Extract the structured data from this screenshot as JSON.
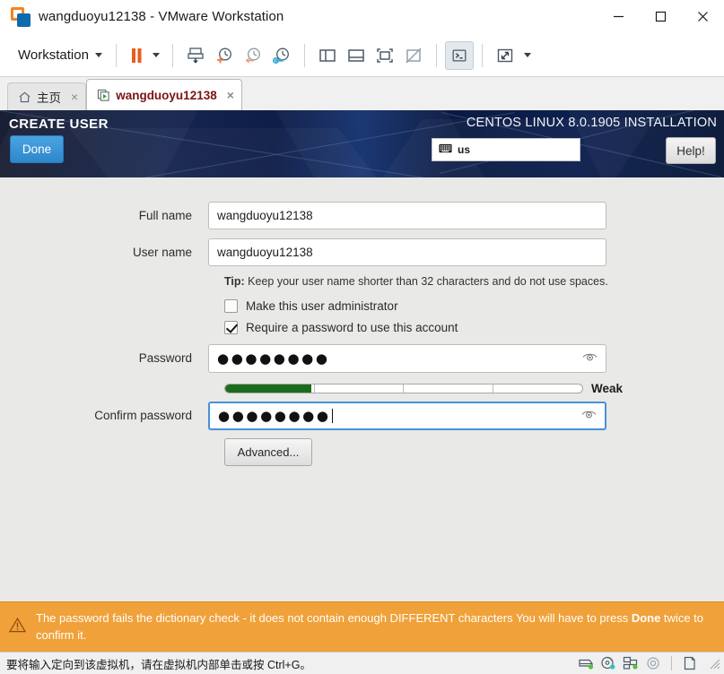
{
  "window": {
    "title": "wangduoyu12138 - VMware Workstation",
    "logo_icon": "vmware-logo-icon",
    "minimize_label": "minimize-icon",
    "maximize_label": "maximize-icon",
    "close_label": "close-icon"
  },
  "toolbar": {
    "menu_label": "Workstation",
    "buttons": [
      {
        "name": "pause-button",
        "icon": "pause-icon"
      },
      {
        "name": "pause-dropdown",
        "icon": "chevron-down-icon"
      },
      {
        "name": "manage-snapshot-button",
        "icon": "snapshot-manage-icon"
      },
      {
        "name": "take-snapshot-button",
        "icon": "snapshot-take-icon"
      },
      {
        "name": "revert-snapshot-button",
        "icon": "snapshot-revert-icon"
      },
      {
        "name": "snapshot-manager-button",
        "icon": "snapshot-manager-icon"
      },
      {
        "name": "show-library-button",
        "icon": "panel-left-icon"
      },
      {
        "name": "show-thumbnail-bar-button",
        "icon": "panel-bottom-icon"
      },
      {
        "name": "full-screen-button",
        "icon": "fullscreen-icon"
      },
      {
        "name": "unity-mode-button",
        "icon": "unity-disabled-icon"
      },
      {
        "name": "console-view-button",
        "icon": "console-prompt-icon"
      },
      {
        "name": "stretch-view-button",
        "icon": "expand-arrows-icon"
      },
      {
        "name": "stretch-view-dropdown",
        "icon": "chevron-down-icon"
      }
    ]
  },
  "tabs": [
    {
      "label": "主页",
      "icon": "home-icon",
      "active": false,
      "close": "×"
    },
    {
      "label": "wangduoyu12138",
      "icon": "vm-running-icon",
      "active": true,
      "close": "×"
    }
  ],
  "installer": {
    "spoke_title": "CREATE USER",
    "done_label": "Done",
    "product_title": "CENTOS LINUX 8.0.1905 INSTALLATION",
    "keyboard_layout": "us",
    "keyboard_icon": "keyboard-icon",
    "help_label": "Help!",
    "form": {
      "full_name_label": "Full name",
      "full_name_value": "wangduoyu12138",
      "user_name_label": "User name",
      "user_name_value": "wangduoyu12138",
      "tip_prefix": "Tip:",
      "tip_text": " Keep your user name shorter than 32 characters and do not use spaces.",
      "admin_checkbox_label": "Make this user administrator",
      "admin_checked": false,
      "require_password_label": "Require a password to use this account",
      "require_password_checked": true,
      "password_label": "Password",
      "password_dots": "●●●●●●●●",
      "password_reveal_icon": "eye-icon",
      "strength_percent": 24,
      "strength_label": "Weak",
      "strength_color": "#1b6b1b",
      "confirm_label": "Confirm password",
      "confirm_dots": "●●●●●●●●",
      "confirm_reveal_icon": "eye-icon",
      "confirm_focused": true,
      "advanced_label": "Advanced..."
    },
    "warning": {
      "icon": "warning-triangle-icon",
      "text_part1": "The password fails the dictionary check - it does not contain enough DIFFERENT characters You will have to press ",
      "text_bold": "Done",
      "text_part2": " twice to confirm it."
    }
  },
  "statusbar": {
    "message": "要将输入定向到该虚拟机，请在虚拟机内部单击或按 Ctrl+G。",
    "devices": [
      {
        "name": "hard-disk-icon"
      },
      {
        "name": "cd-dvd-icon"
      },
      {
        "name": "network-adapter-icon"
      },
      {
        "name": "sound-card-icon"
      },
      {
        "name": "printer-icon"
      }
    ]
  },
  "colors": {
    "accent_blue": "#2e87cc",
    "warning_orange": "#f0a139",
    "header_navy": "#0b1b46",
    "strength_green": "#1b6b1b",
    "focus_blue": "#4a90d9"
  }
}
